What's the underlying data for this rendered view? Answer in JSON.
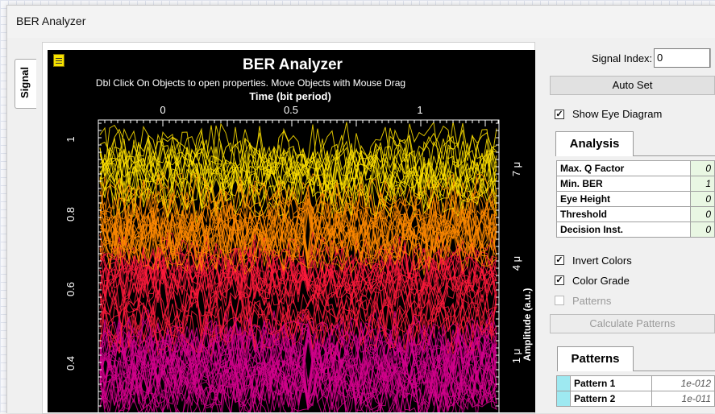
{
  "window": {
    "title": "BER Analyzer"
  },
  "side_tab": {
    "label": "Signal"
  },
  "plot": {
    "title": "BER Analyzer",
    "hint": "Dbl Click On Objects to open properties.  Move Objects with Mouse Drag",
    "x_axis_title": "Time (bit period)",
    "x_ticks": [
      "0",
      "0.5",
      "1"
    ],
    "y_ticks": [
      "1",
      "0.8",
      "0.6",
      "0.4"
    ],
    "right_ticks": [
      "7 μ",
      "4 μ",
      "1 μ"
    ],
    "right_axis_title": "Amplitude (a.u.)",
    "colors": {
      "background": "#000000",
      "bright": "#ffe000",
      "mid": "#ff8a00",
      "low": "#ff1a3c",
      "deep": "#d3008c"
    }
  },
  "chart_data": {
    "type": "line",
    "title": "BER Analyzer",
    "xlabel": "Time (bit period)",
    "ylabel": "Amplitude (a.u.)",
    "x_ticks": [
      0,
      0.5,
      1
    ],
    "y_ticks_left": [
      1,
      0.8,
      0.6,
      0.4
    ],
    "y_ticks_right": [
      "7 μ",
      "4 μ",
      "1 μ"
    ],
    "xlim": [
      -0.25,
      1.25
    ],
    "ylim": [
      0.3,
      1.0
    ],
    "series": [
      {
        "values": []
      }
    ]
  },
  "controls": {
    "signal_index_label": "Signal Index:",
    "signal_index_value": "0",
    "auto_set_label": "Auto Set",
    "show_eye_diagram_label": "Show Eye Diagram",
    "show_eye_diagram_checked": true,
    "invert_colors_label": "Invert Colors",
    "invert_colors_checked": true,
    "color_grade_label": "Color Grade",
    "color_grade_checked": true,
    "patterns_label": "Patterns",
    "patterns_checked": false,
    "calculate_patterns_label": "Calculate Patterns"
  },
  "analysis": {
    "tab_label": "Analysis",
    "rows": [
      {
        "key": "Max. Q Factor",
        "value": "0"
      },
      {
        "key": "Min. BER",
        "value": "1"
      },
      {
        "key": "Eye Height",
        "value": "0"
      },
      {
        "key": "Threshold",
        "value": "0"
      },
      {
        "key": "Decision Inst.",
        "value": "0"
      }
    ]
  },
  "patterns": {
    "tab_label": "Patterns",
    "rows": [
      {
        "name": "Pattern 1",
        "value": "1e-012"
      },
      {
        "name": "Pattern 2",
        "value": "1e-011"
      }
    ]
  }
}
